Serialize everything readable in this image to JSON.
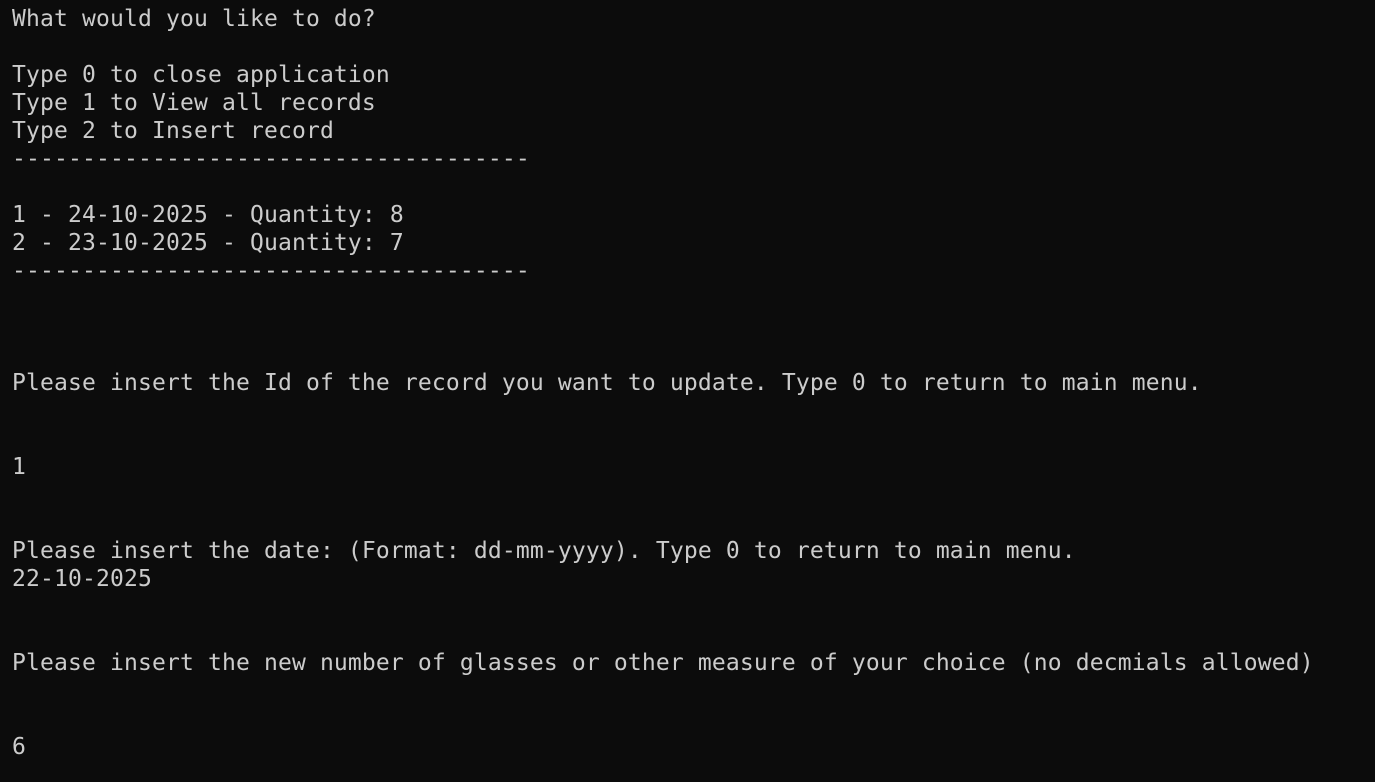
{
  "terminal": {
    "menu_prompt": "What would you like to do?",
    "menu_options": [
      "Type 0 to close application",
      "Type 1 to View all records",
      "Type 2 to Insert record"
    ],
    "separator": "-------------------------------------",
    "records": [
      "1 - 24-10-2025 - Quantity: 8",
      "2 - 23-10-2025 - Quantity: 7"
    ],
    "update_id_prompt": "Please insert the Id of the record you want to update. Type 0 to return to main menu.",
    "id_input": "1",
    "date_prompt": "Please insert the date: (Format: dd-mm-yyyy). Type 0 to return to main menu.",
    "date_input": "22-10-2025",
    "quantity_prompt": "Please insert the new number of glasses or other measure of your choice (no decmials allowed)",
    "quantity_input": "6"
  }
}
